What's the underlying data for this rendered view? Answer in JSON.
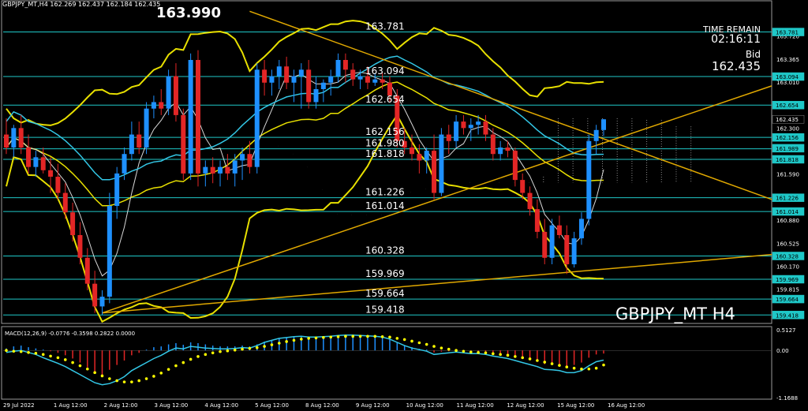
{
  "header": {
    "symbol_info": "GBPJPY_MT,H4  162.269 162.437 162.184 162.435"
  },
  "max_label": "163.990",
  "time_remain": {
    "label": "TIME REMAIN",
    "value": "02:16:11"
  },
  "bid": {
    "label": "Bid",
    "value": "162.435"
  },
  "symbol_label": "GBPJPY_MT H4",
  "macd": {
    "label": "MACD(12,26,9) -0.0776 -0.3598 0.2822 0.0000",
    "ticks": [
      "0.5127",
      "0.00",
      "-1.1688"
    ]
  },
  "colors": {
    "bull": "#1e90ff",
    "bear": "#e32626",
    "hline": "#1fc8c8",
    "band": "#e8e000",
    "trend": "#e0a800",
    "ma": "#d8d8d8",
    "signal": "#ffff00",
    "macd_line": "#33c7e6"
  },
  "chart_data": {
    "type": "candlestick",
    "title": "GBPJPY_MT H4",
    "price_axis_ticks": [
      163.72,
      163.365,
      163.01,
      162.3,
      161.59,
      160.88,
      160.525,
      160.17,
      159.815,
      159.455
    ],
    "price_axis_tags": [
      163.781,
      163.094,
      162.654,
      162.435,
      162.156,
      161.989,
      161.818,
      161.226,
      161.014,
      160.328,
      159.969,
      159.664,
      159.418
    ],
    "horizontal_levels": [
      163.781,
      163.094,
      162.654,
      162.156,
      161.98,
      161.818,
      161.226,
      161.014,
      160.328,
      159.969,
      159.664,
      159.418
    ],
    "time_labels": [
      "29 Jul 2022",
      "1 Aug 12:00",
      "2 Aug 12:00",
      "3 Aug 12:00",
      "4 Aug 12:00",
      "5 Aug 12:00",
      "8 Aug 12:00",
      "9 Aug 12:00",
      "10 Aug 12:00",
      "11 Aug 12:00",
      "12 Aug 12:00",
      "15 Aug 12:00",
      "16 Aug 12:00"
    ],
    "ylim": [
      159.3,
      164.25
    ],
    "candles": [
      {
        "o": 162.2,
        "h": 162.45,
        "l": 161.9,
        "c": 162.0
      },
      {
        "o": 162.0,
        "h": 162.35,
        "l": 161.85,
        "c": 162.3
      },
      {
        "o": 162.3,
        "h": 162.5,
        "l": 161.9,
        "c": 162.0
      },
      {
        "o": 162.0,
        "h": 162.2,
        "l": 161.6,
        "c": 161.7
      },
      {
        "o": 161.7,
        "h": 161.95,
        "l": 161.55,
        "c": 161.85
      },
      {
        "o": 161.85,
        "h": 162.0,
        "l": 161.6,
        "c": 161.65
      },
      {
        "o": 161.65,
        "h": 161.85,
        "l": 161.3,
        "c": 161.55
      },
      {
        "o": 161.55,
        "h": 161.75,
        "l": 161.2,
        "c": 161.3
      },
      {
        "o": 161.3,
        "h": 161.45,
        "l": 160.9,
        "c": 161.0
      },
      {
        "o": 161.0,
        "h": 161.15,
        "l": 160.55,
        "c": 160.65
      },
      {
        "o": 160.65,
        "h": 160.85,
        "l": 160.2,
        "c": 160.3
      },
      {
        "o": 160.3,
        "h": 160.45,
        "l": 159.8,
        "c": 159.9
      },
      {
        "o": 159.9,
        "h": 160.1,
        "l": 159.45,
        "c": 159.55
      },
      {
        "o": 159.55,
        "h": 159.8,
        "l": 159.42,
        "c": 159.7
      },
      {
        "o": 159.7,
        "h": 161.3,
        "l": 159.6,
        "c": 161.1
      },
      {
        "o": 161.1,
        "h": 161.7,
        "l": 160.9,
        "c": 161.6
      },
      {
        "o": 161.6,
        "h": 162.0,
        "l": 161.5,
        "c": 161.9
      },
      {
        "o": 161.9,
        "h": 162.4,
        "l": 161.8,
        "c": 162.2
      },
      {
        "o": 162.2,
        "h": 162.4,
        "l": 161.9,
        "c": 162.0
      },
      {
        "o": 162.0,
        "h": 162.7,
        "l": 161.9,
        "c": 162.6
      },
      {
        "o": 162.6,
        "h": 162.8,
        "l": 162.45,
        "c": 162.7
      },
      {
        "o": 162.7,
        "h": 162.9,
        "l": 162.5,
        "c": 162.6
      },
      {
        "o": 162.6,
        "h": 163.2,
        "l": 162.5,
        "c": 163.1
      },
      {
        "o": 163.1,
        "h": 163.3,
        "l": 162.4,
        "c": 162.5
      },
      {
        "o": 162.5,
        "h": 162.6,
        "l": 161.5,
        "c": 161.6
      },
      {
        "o": 161.6,
        "h": 163.45,
        "l": 161.5,
        "c": 163.35
      },
      {
        "o": 163.35,
        "h": 163.5,
        "l": 161.4,
        "c": 161.6
      },
      {
        "o": 161.6,
        "h": 161.8,
        "l": 161.4,
        "c": 161.7
      },
      {
        "o": 161.7,
        "h": 161.85,
        "l": 161.45,
        "c": 161.6
      },
      {
        "o": 161.6,
        "h": 161.8,
        "l": 161.4,
        "c": 161.7
      },
      {
        "o": 161.7,
        "h": 161.9,
        "l": 161.5,
        "c": 161.6
      },
      {
        "o": 161.6,
        "h": 161.9,
        "l": 161.4,
        "c": 161.8
      },
      {
        "o": 161.8,
        "h": 162.0,
        "l": 161.5,
        "c": 161.9
      },
      {
        "o": 161.9,
        "h": 162.1,
        "l": 161.6,
        "c": 161.7
      },
      {
        "o": 161.7,
        "h": 163.3,
        "l": 161.6,
        "c": 163.2
      },
      {
        "o": 163.2,
        "h": 163.35,
        "l": 162.8,
        "c": 163.0
      },
      {
        "o": 163.0,
        "h": 163.2,
        "l": 162.8,
        "c": 163.1
      },
      {
        "o": 163.1,
        "h": 163.35,
        "l": 162.9,
        "c": 163.25
      },
      {
        "o": 163.25,
        "h": 163.4,
        "l": 162.9,
        "c": 163.0
      },
      {
        "o": 163.0,
        "h": 163.2,
        "l": 162.7,
        "c": 163.1
      },
      {
        "o": 163.1,
        "h": 163.3,
        "l": 162.6,
        "c": 163.2
      },
      {
        "o": 163.2,
        "h": 163.35,
        "l": 162.6,
        "c": 162.7
      },
      {
        "o": 162.7,
        "h": 163.1,
        "l": 162.6,
        "c": 162.9
      },
      {
        "o": 162.9,
        "h": 163.05,
        "l": 162.7,
        "c": 163.0
      },
      {
        "o": 163.0,
        "h": 163.2,
        "l": 162.8,
        "c": 163.1
      },
      {
        "o": 163.1,
        "h": 163.45,
        "l": 163.0,
        "c": 163.35
      },
      {
        "o": 163.35,
        "h": 163.45,
        "l": 163.0,
        "c": 163.2
      },
      {
        "o": 163.2,
        "h": 163.3,
        "l": 162.95,
        "c": 163.05
      },
      {
        "o": 163.05,
        "h": 163.2,
        "l": 162.9,
        "c": 163.1
      },
      {
        "o": 163.1,
        "h": 163.25,
        "l": 162.9,
        "c": 163.0
      },
      {
        "o": 163.0,
        "h": 163.15,
        "l": 162.95,
        "c": 163.05
      },
      {
        "o": 163.05,
        "h": 163.15,
        "l": 162.9,
        "c": 163.0
      },
      {
        "o": 163.0,
        "h": 163.1,
        "l": 162.7,
        "c": 162.8
      },
      {
        "o": 162.8,
        "h": 162.9,
        "l": 162.0,
        "c": 162.1
      },
      {
        "o": 162.1,
        "h": 162.3,
        "l": 161.9,
        "c": 162.0
      },
      {
        "o": 162.0,
        "h": 162.2,
        "l": 161.8,
        "c": 161.9
      },
      {
        "o": 161.9,
        "h": 162.05,
        "l": 161.6,
        "c": 161.8
      },
      {
        "o": 161.8,
        "h": 162.0,
        "l": 161.6,
        "c": 161.95
      },
      {
        "o": 161.95,
        "h": 162.2,
        "l": 161.2,
        "c": 161.3
      },
      {
        "o": 161.3,
        "h": 162.3,
        "l": 161.25,
        "c": 162.2
      },
      {
        "o": 162.2,
        "h": 162.35,
        "l": 161.9,
        "c": 162.1
      },
      {
        "o": 162.1,
        "h": 162.5,
        "l": 162.0,
        "c": 162.4
      },
      {
        "o": 162.4,
        "h": 162.5,
        "l": 162.2,
        "c": 162.3
      },
      {
        "o": 162.3,
        "h": 162.45,
        "l": 162.1,
        "c": 162.35
      },
      {
        "o": 162.35,
        "h": 162.5,
        "l": 162.2,
        "c": 162.4
      },
      {
        "o": 162.4,
        "h": 162.5,
        "l": 162.1,
        "c": 162.2
      },
      {
        "o": 162.2,
        "h": 162.3,
        "l": 161.8,
        "c": 161.9
      },
      {
        "o": 161.9,
        "h": 162.1,
        "l": 161.8,
        "c": 162.0
      },
      {
        "o": 162.0,
        "h": 162.1,
        "l": 161.85,
        "c": 161.95
      },
      {
        "o": 161.95,
        "h": 162.0,
        "l": 161.4,
        "c": 161.5
      },
      {
        "o": 161.5,
        "h": 161.6,
        "l": 161.2,
        "c": 161.3
      },
      {
        "o": 161.3,
        "h": 161.4,
        "l": 160.95,
        "c": 161.05
      },
      {
        "o": 161.05,
        "h": 161.2,
        "l": 160.6,
        "c": 160.7
      },
      {
        "o": 160.7,
        "h": 160.9,
        "l": 160.2,
        "c": 160.3
      },
      {
        "o": 160.3,
        "h": 160.9,
        "l": 160.2,
        "c": 160.8
      },
      {
        "o": 160.8,
        "h": 160.95,
        "l": 160.6,
        "c": 160.65
      },
      {
        "o": 160.65,
        "h": 160.8,
        "l": 160.05,
        "c": 160.2
      },
      {
        "o": 160.2,
        "h": 160.7,
        "l": 160.15,
        "c": 160.6
      },
      {
        "o": 160.6,
        "h": 161.0,
        "l": 160.5,
        "c": 160.9
      },
      {
        "o": 160.9,
        "h": 162.2,
        "l": 160.8,
        "c": 162.1
      },
      {
        "o": 162.1,
        "h": 162.35,
        "l": 161.9,
        "c": 162.27
      },
      {
        "o": 162.27,
        "h": 162.44,
        "l": 162.18,
        "c": 162.435
      }
    ],
    "macd_hist": [
      0.05,
      0.1,
      0.12,
      0.08,
      0.05,
      0.02,
      -0.02,
      -0.06,
      -0.12,
      -0.2,
      -0.3,
      -0.42,
      -0.55,
      -0.6,
      -0.48,
      -0.36,
      -0.25,
      -0.12,
      -0.06,
      0.02,
      0.08,
      0.1,
      0.15,
      0.18,
      0.14,
      0.2,
      0.18,
      0.15,
      0.12,
      0.1,
      0.1,
      0.1,
      0.12,
      0.1,
      0.15,
      0.22,
      0.26,
      0.3,
      0.32,
      0.33,
      0.34,
      0.32,
      0.32,
      0.33,
      0.34,
      0.36,
      0.37,
      0.37,
      0.36,
      0.35,
      0.34,
      0.32,
      0.28,
      0.2,
      0.12,
      0.08,
      0.04,
      0.02,
      -0.05,
      -0.03,
      -0.02,
      0.0,
      -0.02,
      -0.03,
      -0.02,
      -0.04,
      -0.08,
      -0.1,
      -0.12,
      -0.16,
      -0.2,
      -0.24,
      -0.28,
      -0.34,
      -0.33,
      -0.34,
      -0.38,
      -0.36,
      -0.3,
      -0.18,
      -0.1,
      -0.0776
    ],
    "macd_line": [
      -0.05,
      -0.02,
      0.0,
      -0.05,
      -0.1,
      -0.18,
      -0.25,
      -0.32,
      -0.4,
      -0.5,
      -0.6,
      -0.7,
      -0.8,
      -0.85,
      -0.82,
      -0.75,
      -0.65,
      -0.5,
      -0.4,
      -0.3,
      -0.2,
      -0.12,
      -0.02,
      0.06,
      0.04,
      0.1,
      0.08,
      0.06,
      0.05,
      0.04,
      0.04,
      0.05,
      0.07,
      0.06,
      0.12,
      0.2,
      0.25,
      0.3,
      0.32,
      0.34,
      0.35,
      0.33,
      0.33,
      0.34,
      0.35,
      0.37,
      0.38,
      0.38,
      0.37,
      0.36,
      0.35,
      0.33,
      0.28,
      0.2,
      0.12,
      0.06,
      0.02,
      -0.02,
      -0.1,
      -0.08,
      -0.06,
      -0.04,
      -0.06,
      -0.08,
      -0.08,
      -0.1,
      -0.14,
      -0.17,
      -0.2,
      -0.25,
      -0.3,
      -0.35,
      -0.4,
      -0.47,
      -0.48,
      -0.5,
      -0.55,
      -0.55,
      -0.5,
      -0.38,
      -0.28,
      -0.24
    ],
    "signal_line": [
      0.0,
      -0.02,
      -0.03,
      -0.05,
      -0.07,
      -0.1,
      -0.14,
      -0.18,
      -0.23,
      -0.3,
      -0.38,
      -0.46,
      -0.55,
      -0.63,
      -0.7,
      -0.75,
      -0.78,
      -0.78,
      -0.75,
      -0.7,
      -0.64,
      -0.56,
      -0.47,
      -0.38,
      -0.3,
      -0.22,
      -0.15,
      -0.1,
      -0.06,
      -0.03,
      -0.01,
      0.01,
      0.03,
      0.05,
      0.07,
      0.1,
      0.14,
      0.18,
      0.22,
      0.25,
      0.28,
      0.3,
      0.31,
      0.32,
      0.33,
      0.34,
      0.35,
      0.35,
      0.35,
      0.35,
      0.35,
      0.34,
      0.33,
      0.3,
      0.27,
      0.23,
      0.19,
      0.15,
      0.1,
      0.06,
      0.03,
      0.0,
      -0.02,
      -0.04,
      -0.05,
      -0.06,
      -0.08,
      -0.1,
      -0.12,
      -0.15,
      -0.18,
      -0.21,
      -0.25,
      -0.29,
      -0.33,
      -0.37,
      -0.41,
      -0.44,
      -0.46,
      -0.46,
      -0.44,
      -0.3598
    ]
  }
}
